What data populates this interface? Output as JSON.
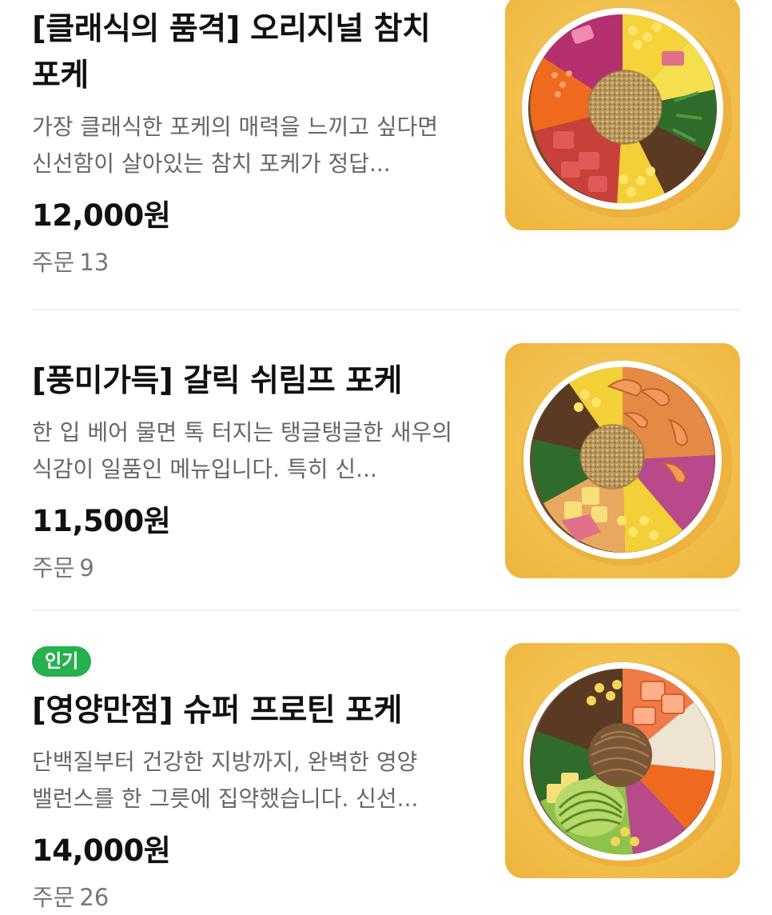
{
  "items": [
    {
      "title": "[클래식의 품격] 오리지널 참치 포케",
      "description": "가장 클래식한 포케의 매력을 느끼고 싶다면 신선함이 살아있는 참치 포케가 정답...",
      "price": "12,000원",
      "orders_label": "주문",
      "orders_count": "13",
      "image": "tuna-poke-bowl-photo"
    },
    {
      "title": "[풍미가득] 갈릭 쉬림프 포케",
      "description": "한 입 베어 물면 톡 터지는 탱글탱글한 새우의 식감이 일품인 메뉴입니다. 특히 신...",
      "price": "11,500원",
      "orders_label": "주문",
      "orders_count": "9",
      "image": "shrimp-poke-bowl-photo"
    },
    {
      "badge": "인기",
      "title": "[영양만점] 슈퍼 프로틴 포케",
      "description": "단백질부터 건강한 지방까지, 완벽한 영양 밸런스를 한 그릇에 집약했습니다. 신선...",
      "price": "14,000원",
      "orders_label": "주문",
      "orders_count": "26",
      "image": "protein-poke-bowl-photo"
    }
  ],
  "colors": {
    "badge_green": "#26b04f",
    "photo_background": "#f4c452",
    "divider": "#eeeeee",
    "secondary_text": "#666666"
  }
}
